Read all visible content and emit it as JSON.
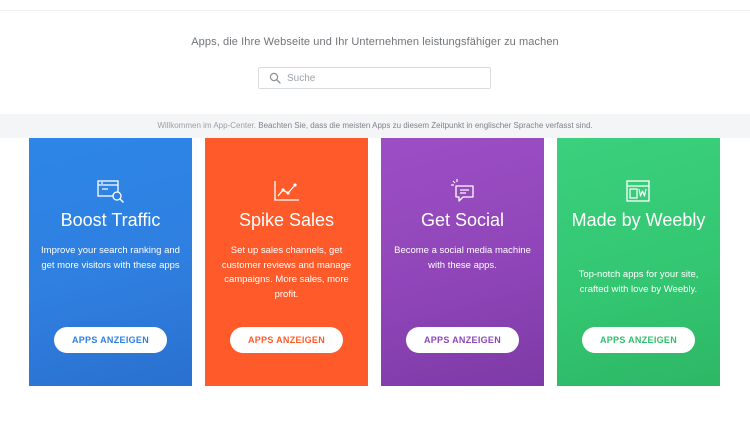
{
  "header": {
    "subtitle": "Apps, die Ihre Webseite und Ihr Unternehmen leistungsfähiger zu machen"
  },
  "search": {
    "placeholder": "Suche",
    "icon": "search-icon"
  },
  "notice": {
    "welcome": "Willkommen im App-Center.",
    "message": "Beachten Sie, dass die meisten Apps zu diesem Zeitpunkt in englischer Sprache verfasst sind."
  },
  "cards": [
    {
      "title": "Boost Traffic",
      "description": "Improve your search ranking and get more visitors with these apps",
      "button": "APPS ANZEIGEN",
      "icon": "browser-search-icon",
      "color": "#2f7fe0"
    },
    {
      "title": "Spike Sales",
      "description": "Set up sales channels, get customer reviews and manage campaigns. More sales, more profit.",
      "button": "APPS ANZEIGEN",
      "icon": "line-chart-icon",
      "color": "#ff5a2a"
    },
    {
      "title": "Get Social",
      "description": "Become a social media machine with these apps.",
      "button": "APPS ANZEIGEN",
      "icon": "chat-bubble-icon",
      "color": "#8e46b8"
    },
    {
      "title": "Made by Weebly",
      "description": "Top-notch apps for your site, crafted with love by Weebly.",
      "button": "APPS ANZEIGEN",
      "icon": "weebly-layout-icon",
      "color": "#2fbf6b"
    }
  ]
}
